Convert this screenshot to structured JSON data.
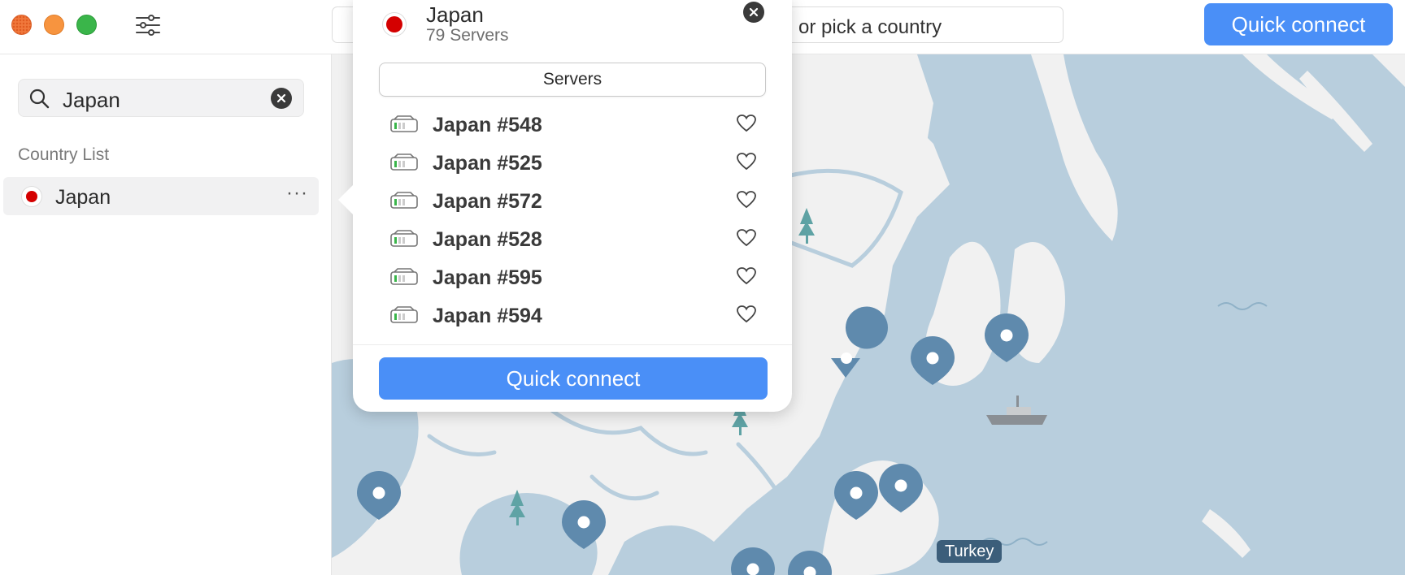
{
  "titlebar": {
    "search_text": "or pick a country",
    "quick_connect_label": "Quick connect"
  },
  "sidebar": {
    "search_value": "Japan",
    "section_label": "Country List",
    "country": {
      "name": "Japan",
      "more_label": "···"
    }
  },
  "popover": {
    "country": "Japan",
    "server_count": "79 Servers",
    "segment_label": "Servers",
    "servers": [
      "Japan #548",
      "Japan #525",
      "Japan #572",
      "Japan #528",
      "Japan #595",
      "Japan #594"
    ],
    "quick_connect_label": "Quick connect"
  },
  "map": {
    "label": "Turkey"
  },
  "colors": {
    "accent": "#4a8ff7",
    "water": "#b8cedd",
    "land": "#f1f1f1",
    "pin": "#5f8aad",
    "flag_red": "#d40000"
  }
}
